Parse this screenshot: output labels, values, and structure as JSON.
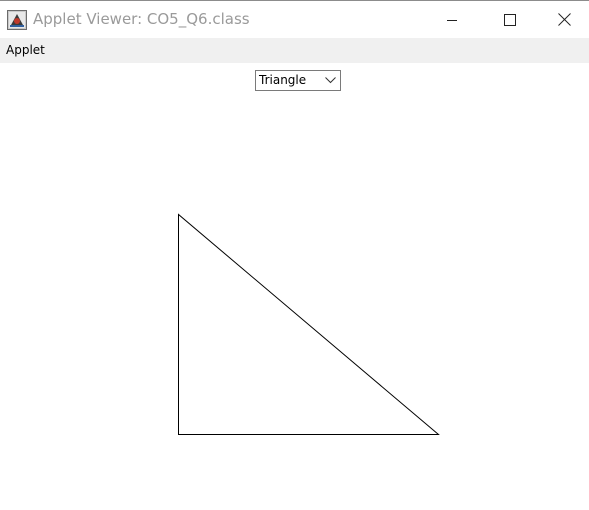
{
  "window": {
    "title": "Applet Viewer: CO5_Q6.class",
    "icon": "java-applet-icon",
    "controls": {
      "minimize_icon": "minimize-icon",
      "maximize_icon": "maximize-icon",
      "close_icon": "close-icon"
    }
  },
  "menubar": {
    "items": [
      {
        "label": "Applet"
      }
    ]
  },
  "applet": {
    "shape_choice": {
      "selected": "Triangle",
      "icon": "chevron-down-icon"
    },
    "drawn_shape": "triangle",
    "stroke_color": "#000000"
  }
}
